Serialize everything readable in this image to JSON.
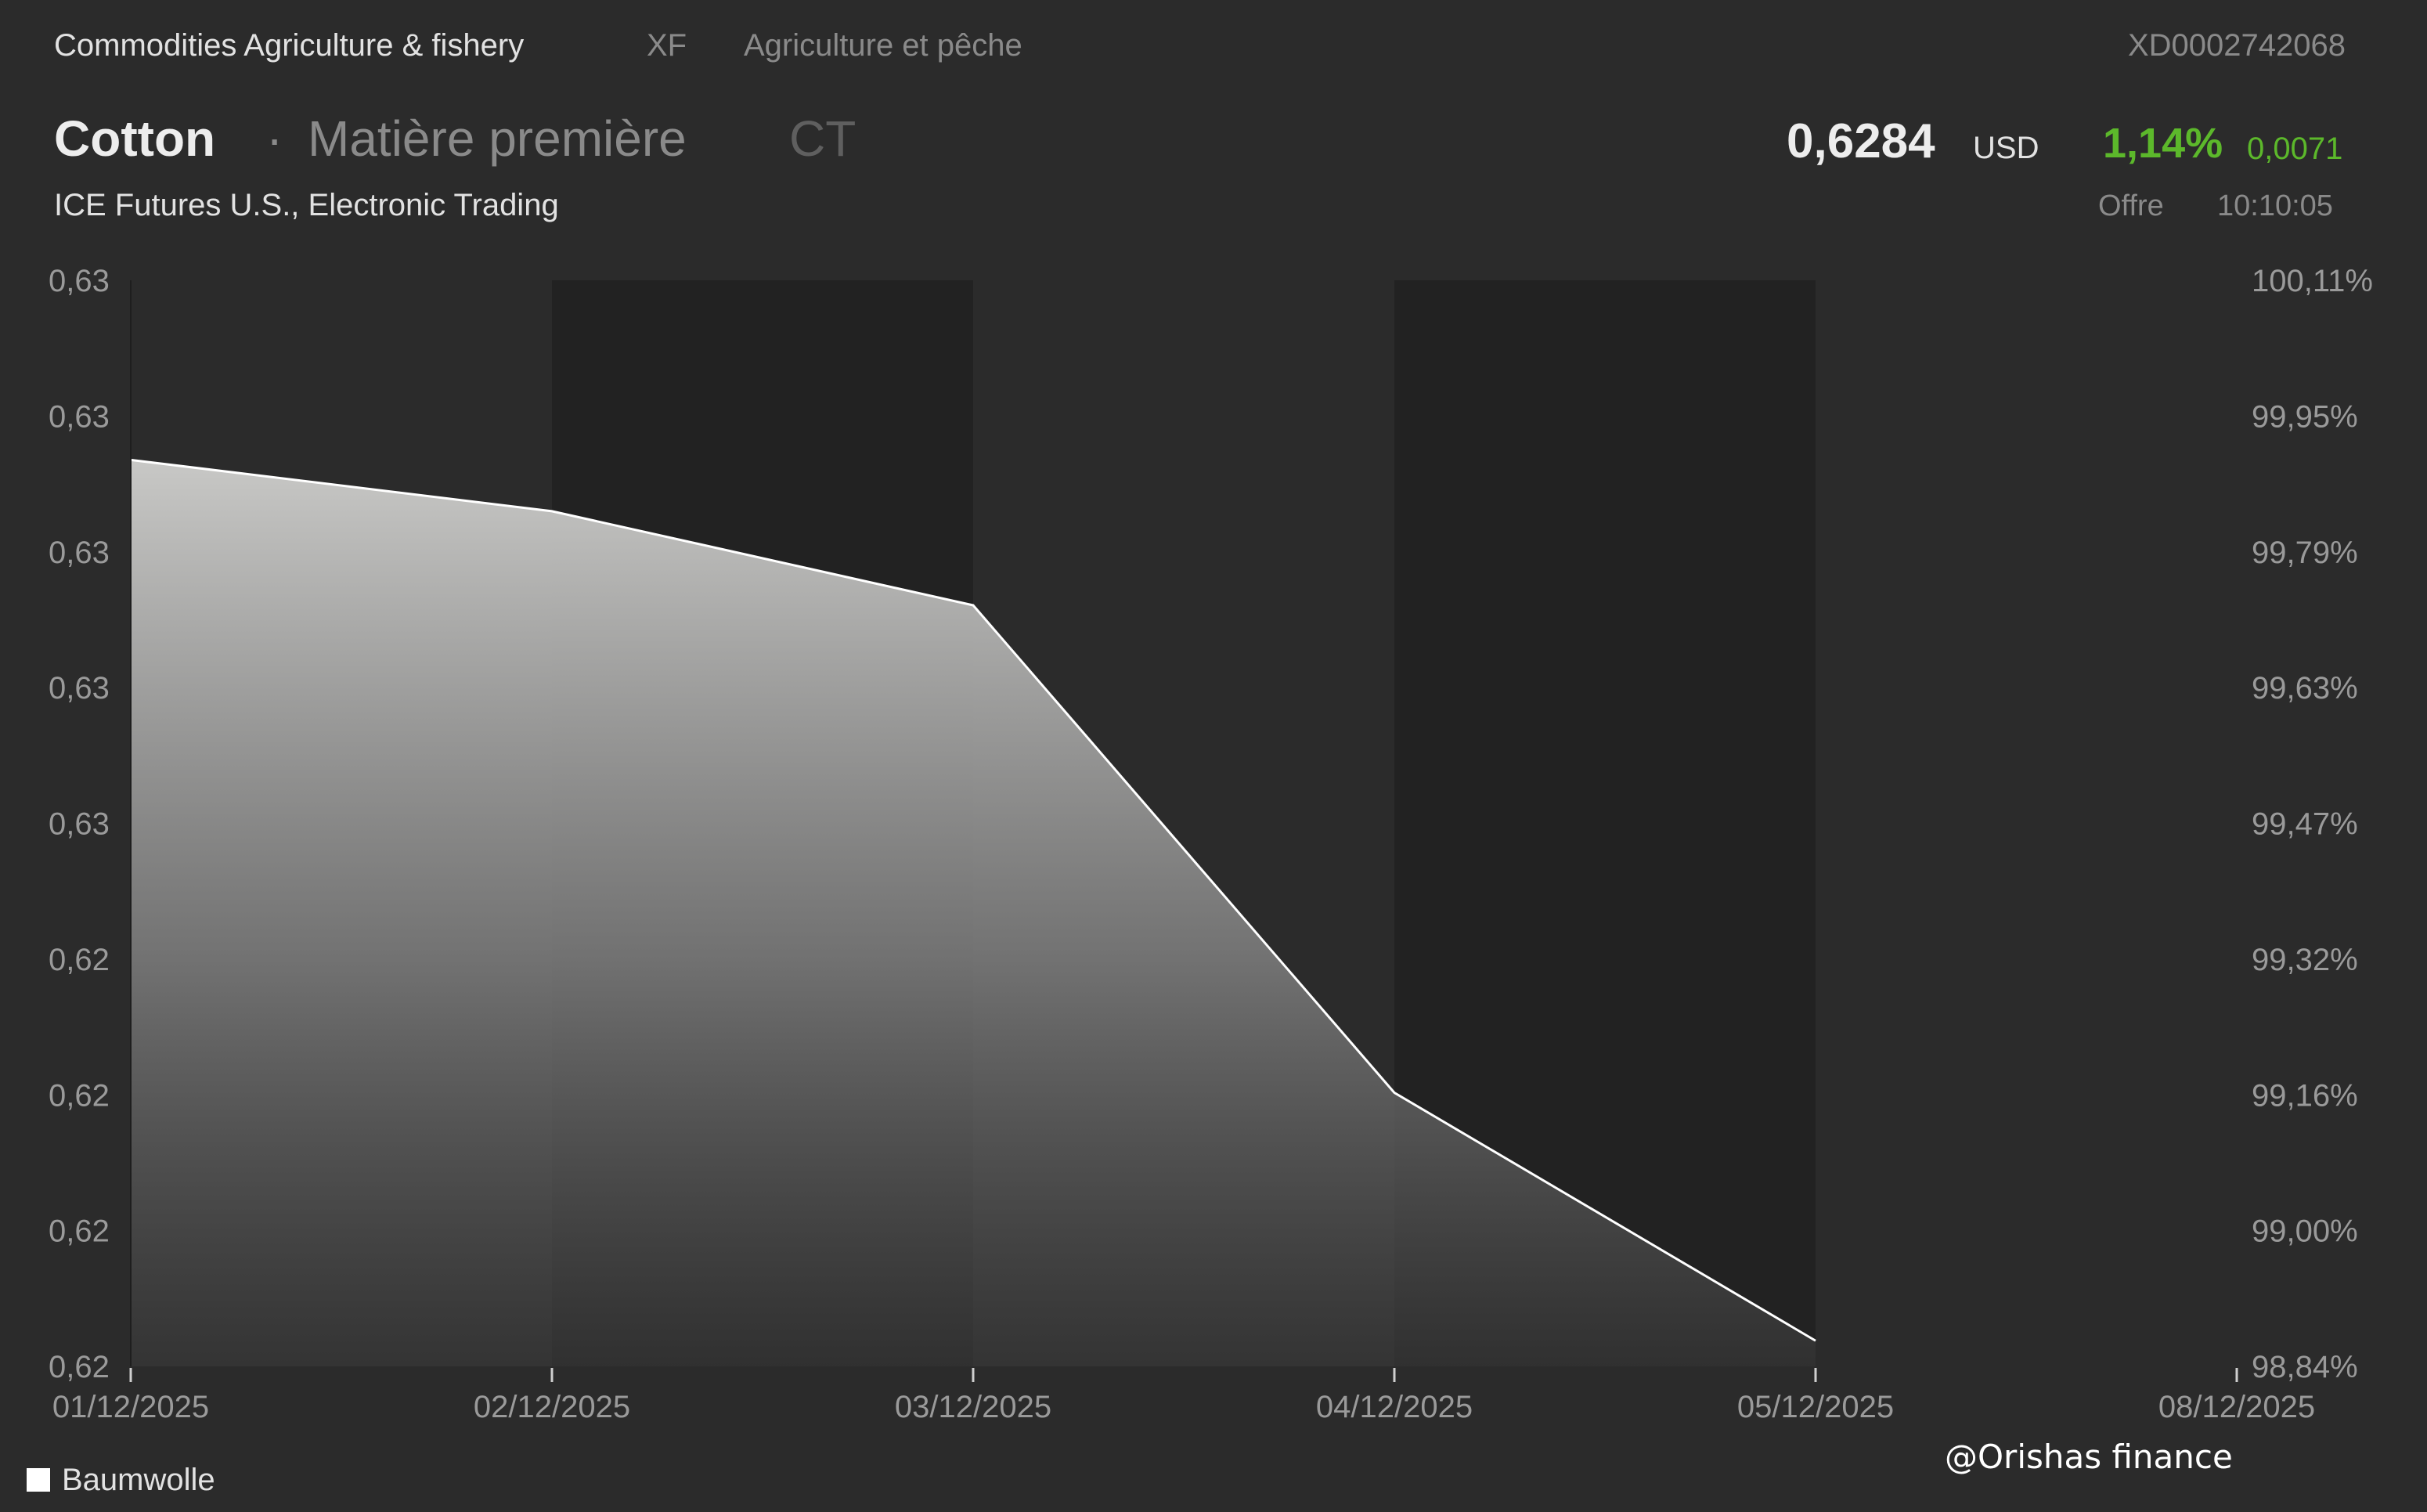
{
  "header": {
    "category": "Commodities Agriculture & fishery",
    "code": "XF",
    "subcategory": "Agriculture et pêche",
    "isin": "XD0002742068",
    "title": "Cotton",
    "separator": "·",
    "type": "Matière première",
    "symbol": "CT",
    "exchange": "ICE Futures U.S., Electronic Trading",
    "price": "0,6284",
    "currency": "USD",
    "change_pct": "1,14%",
    "change_abs": "0,0071",
    "quote_type": "Offre",
    "time": "10:10:05"
  },
  "colors": {
    "background": "#2b2b2b",
    "shaded_band": "#222222",
    "line": "#ffffff",
    "positive": "#5cb82b"
  },
  "chart_data": {
    "type": "area",
    "x": [
      "01/12/2025",
      "02/12/2025",
      "03/12/2025",
      "04/12/2025",
      "05/12/2025"
    ],
    "x_ticks": [
      "01/12/2025",
      "02/12/2025",
      "03/12/2025",
      "04/12/2025",
      "05/12/2025",
      "08/12/2025"
    ],
    "y_pct": [
      99.9,
      99.84,
      99.73,
      99.16,
      98.87
    ],
    "y_ticks_left": [
      "0,63",
      "0,63",
      "0,63",
      "0,63",
      "0,63",
      "0,62",
      "0,62",
      "0,62",
      "0,62"
    ],
    "y_ticks_right": [
      "100,11%",
      "99,95%",
      "99,79%",
      "99,63%",
      "99,47%",
      "99,32%",
      "99,16%",
      "99,00%",
      "98,84%"
    ],
    "ylim_pct": [
      98.84,
      100.11
    ],
    "shaded_days": [
      "02/12/2025",
      "04/12/2025"
    ],
    "legend": "Baumwolle",
    "legend_position": "bottom-left",
    "grid": false
  },
  "watermark": "@Orishas finance"
}
